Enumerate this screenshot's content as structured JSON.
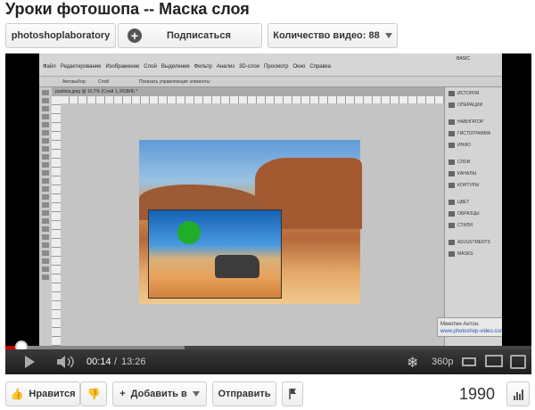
{
  "page": {
    "title": "Уроки фотошопа -- Маска слоя"
  },
  "channel": {
    "name": "photoshoplaboratory",
    "subscribe_label": "Подписаться",
    "video_count": "Количество видео: 88"
  },
  "video": {
    "app": {
      "menu": [
        "Файл",
        "Редактирование",
        "Изображение",
        "Слой",
        "Выделение",
        "Фильтр",
        "Анализ",
        "3D-слои",
        "Просмотр",
        "Окно",
        "Справка"
      ],
      "workspace": "BASIC",
      "options_bar": {
        "autoselect": "Автовыбор:",
        "layer_option": "Слой",
        "transform": "Показать управляющие элементы"
      },
      "doc_tab": "pustinia.jpeg @ 16,7% (Слой 1, RGB/8) *",
      "panels": [
        "ИСТОРИЯ",
        "ОПЕРАЦИИ",
        "НАВИГАТОР",
        "ГИСТОГРАММА",
        "ИНФО",
        "СЛОИ",
        "КАНАЛЫ",
        "КОНТУРЫ",
        "ЦВЕТ",
        "ОБРАЗЦЫ",
        "СТИЛИ",
        "ADJUSTMENTS",
        "MASKS"
      ],
      "watermark": [
        "Мекотин Антон.",
        "www.photoshop-video.com"
      ]
    },
    "time_current": "00:14",
    "time_total": "13:26",
    "time_separator": "/",
    "quality": "360p",
    "progress": {
      "played_percent": 2,
      "buffered_percent": 34
    }
  },
  "actions": {
    "like": "Нравится",
    "add_to": "Добавить в",
    "share": "Отправить"
  },
  "views": "1990",
  "icons": {
    "like": "thumbs-up-icon",
    "dislike": "thumbs-down-icon",
    "plus": "plus-icon",
    "flag": "flag-icon",
    "stats": "bar-chart-icon"
  }
}
